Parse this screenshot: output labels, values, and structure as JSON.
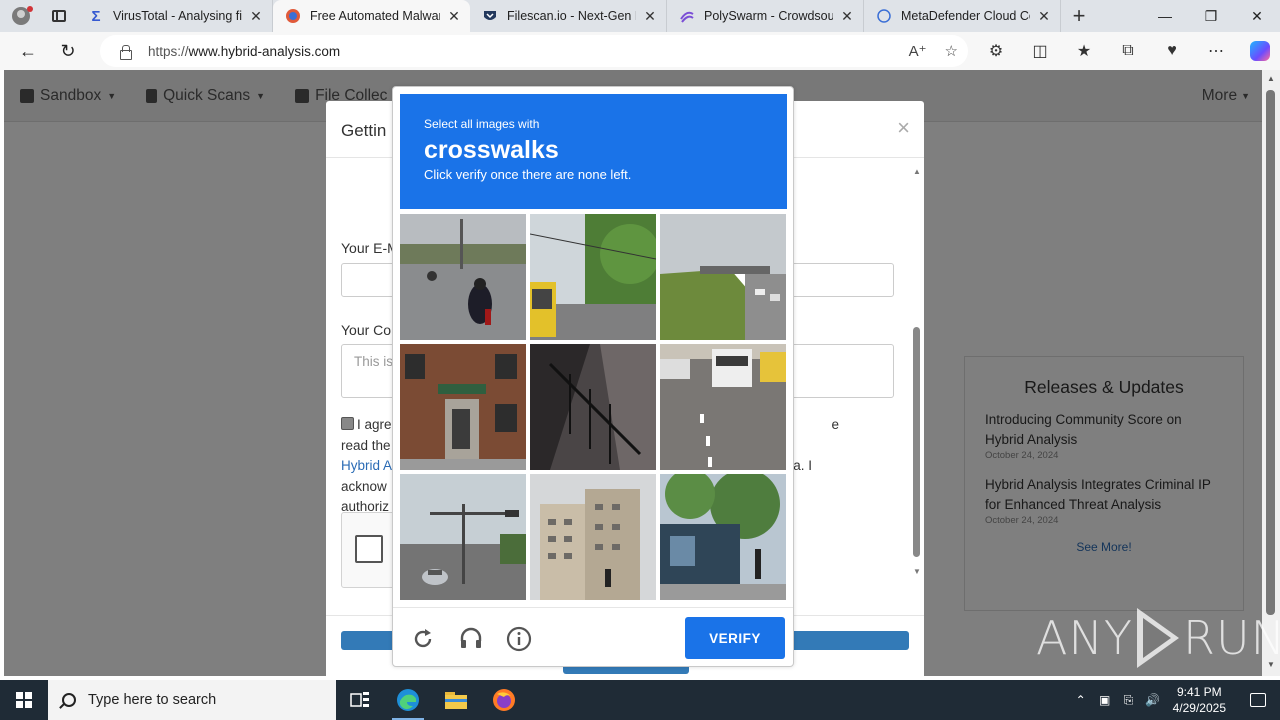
{
  "browser": {
    "tabs": [
      {
        "title": "VirusTotal - Analysing file",
        "icon": "virustotal-icon",
        "active": false
      },
      {
        "title": "Free Automated Malware",
        "icon": "hybrid-analysis-icon",
        "active": true
      },
      {
        "title": "Filescan.io - Next-Gen M",
        "icon": "filescan-icon",
        "active": false
      },
      {
        "title": "PolySwarm - Crowdsourc",
        "icon": "polyswarm-icon",
        "active": false
      },
      {
        "title": "MetaDefender Cloud Co",
        "icon": "loading-icon",
        "active": false
      }
    ],
    "url_scheme": "https://",
    "url_host": "www.hybrid-analysis.com"
  },
  "site": {
    "nav": [
      {
        "label": "Sandbox"
      },
      {
        "label": "Quick Scans"
      },
      {
        "label": "File Collec"
      }
    ],
    "nav_more": "More",
    "releases": {
      "title": "Releases & Updates",
      "items": [
        {
          "title": "Introducing Community Score on Hybrid Analysis",
          "date": "October 24, 2024"
        },
        {
          "title": "Hybrid Analysis Integrates Criminal IP for Enhanced Threat Analysis",
          "date": "October 24, 2024"
        }
      ],
      "see_more": "See More!"
    }
  },
  "modal": {
    "title": "Gettin",
    "email_label": "Your E-M",
    "comment_label": "Your Co",
    "comment_placeholder": "This is",
    "agree_prefix": "I agre",
    "agree_suffix1": "e read the",
    "agree_link": "Hybrid A",
    "agree_suffix2": "ata. I",
    "agree_line3": "acknow",
    "agree_line4": "authoriz"
  },
  "captcha": {
    "prompt_small": "Select all images with",
    "prompt_target": "crosswalks",
    "prompt_sub": "Click verify once there are none left.",
    "verify_label": "VERIFY",
    "tiles": [
      {
        "subject": "motorcyclist on road"
      },
      {
        "subject": "bus on tree lined road"
      },
      {
        "subject": "highway overpass"
      },
      {
        "subject": "brick apartment building"
      },
      {
        "subject": "stairwell railing"
      },
      {
        "subject": "buses on road with dashed lines"
      },
      {
        "subject": "street lights and car"
      },
      {
        "subject": "tall hotel building"
      },
      {
        "subject": "storefront with trees"
      }
    ]
  },
  "watermark": {
    "left": "ANY",
    "right": "RUN"
  },
  "taskbar": {
    "search_placeholder": "Type here to search",
    "time": "9:41 PM",
    "date": "4/29/2025"
  }
}
